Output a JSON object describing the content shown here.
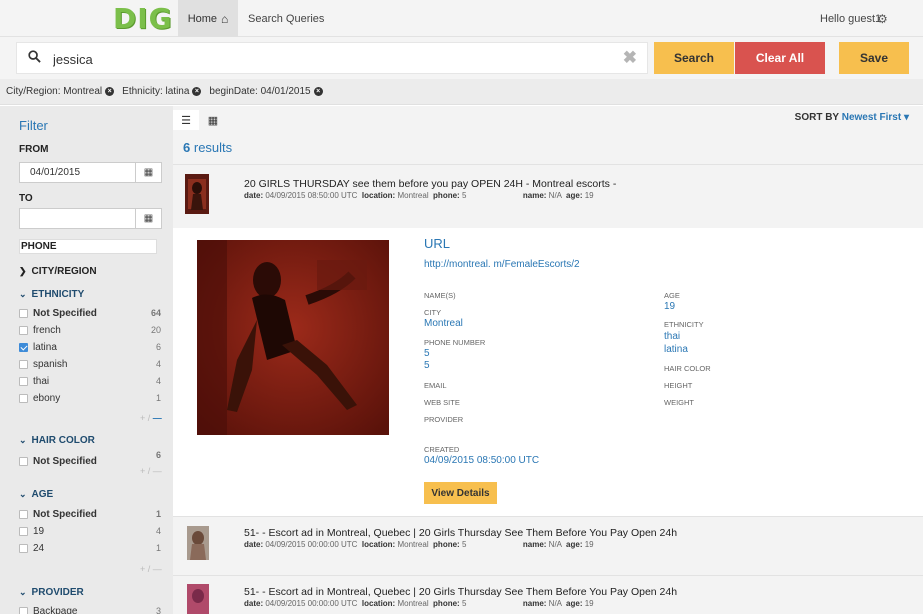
{
  "nav": {
    "logo": "DIG",
    "home_label": "Home",
    "queries_label": "Search Queries",
    "greeting": "Hello guest1"
  },
  "search": {
    "value": "jessica",
    "search_label": "Search",
    "clear_label": "Clear All",
    "save_label": "Save"
  },
  "chips": [
    {
      "label": "City/Region: Montreal"
    },
    {
      "label": "Ethnicity: latina"
    },
    {
      "label": "beginDate: 04/01/2015"
    }
  ],
  "filter": {
    "title": "Filter",
    "from_label": "FROM",
    "from_value": "04/01/2015",
    "to_label": "TO",
    "to_value": "",
    "phone_label": "PHONE",
    "city_label": "CITY/REGION",
    "ethnicity_label": "ETHNICITY",
    "ethnicity_items": [
      {
        "label": "Not Specified",
        "count": "64",
        "checked": false
      },
      {
        "label": "french",
        "count": "20",
        "checked": false
      },
      {
        "label": "latina",
        "count": "6",
        "checked": true
      },
      {
        "label": "spanish",
        "count": "4",
        "checked": false
      },
      {
        "label": "thai",
        "count": "4",
        "checked": false
      },
      {
        "label": "ebony",
        "count": "1",
        "checked": false
      }
    ],
    "hair_label": "HAIR COLOR",
    "hair_items": [
      {
        "label": "Not Specified",
        "count": "6",
        "checked": false
      }
    ],
    "age_label": "AGE",
    "age_items": [
      {
        "label": "Not Specified",
        "count": "1",
        "checked": false
      },
      {
        "label": "19",
        "count": "4",
        "checked": false
      },
      {
        "label": "24",
        "count": "1",
        "checked": false
      }
    ],
    "provider_label": "PROVIDER",
    "provider_items": [
      {
        "label": "Backpage",
        "count": "3",
        "checked": false
      }
    ]
  },
  "results": {
    "sort_label": "SORT BY",
    "sort_value": "Newest First",
    "count_number": "6",
    "count_word": "results",
    "meta_labels": {
      "date": "date:",
      "location": "location:",
      "phone": "phone:",
      "name": "name:",
      "age": "age:"
    },
    "items": [
      {
        "title": "20 GIRLS THURSDAY see them before you pay OPEN 24H - Montreal escorts - ",
        "date": "04/09/2015 08:50:00 UTC",
        "location": "Montreal",
        "phone": "5",
        "name": "N/A",
        "age": "19"
      },
      {
        "title": "51-          - Escort ad in Montreal, Quebec | 20 Girls Thursday See Them Before You Pay Open 24h",
        "date": "04/09/2015 00:00:00 UTC",
        "location": "Montreal",
        "phone": "5",
        "name": "N/A",
        "age": "19"
      },
      {
        "title": "51-          - Escort ad in Montreal, Quebec | 20 Girls Thursday See Them Before You Pay Open 24h",
        "date": "04/09/2015 00:00:00 UTC",
        "location": "Montreal",
        "phone": "5",
        "name": "N/A",
        "age": "19"
      }
    ],
    "detail": {
      "url_heading": "URL",
      "url": "http://montreal.                    m/FemaleEscorts/2",
      "names_label": "NAME(S)",
      "city_label": "CITY",
      "city_value": "Montreal",
      "phone_label": "PHONE NUMBER",
      "phone_1": "5",
      "phone_2": "5",
      "email_label": "EMAIL",
      "website_label": "WEB SITE",
      "provider_label": "PROVIDER",
      "created_label": "CREATED",
      "created_value": "04/09/2015 08:50:00 UTC",
      "age_label": "AGE",
      "age_value": "19",
      "ethnicity_label": "ETHNICITY",
      "ethnicity_1": "thai",
      "ethnicity_2": "latina",
      "hair_label": "HAIR COLOR",
      "height_label": "HEIGHT",
      "weight_label": "WEIGHT",
      "view_details_label": "View Details"
    }
  },
  "colors": {
    "accent_blue": "#2a77b4",
    "yellow_button": "#f7bf4e",
    "red_button": "#d9534f",
    "logo_green": "#7bbf4a"
  }
}
